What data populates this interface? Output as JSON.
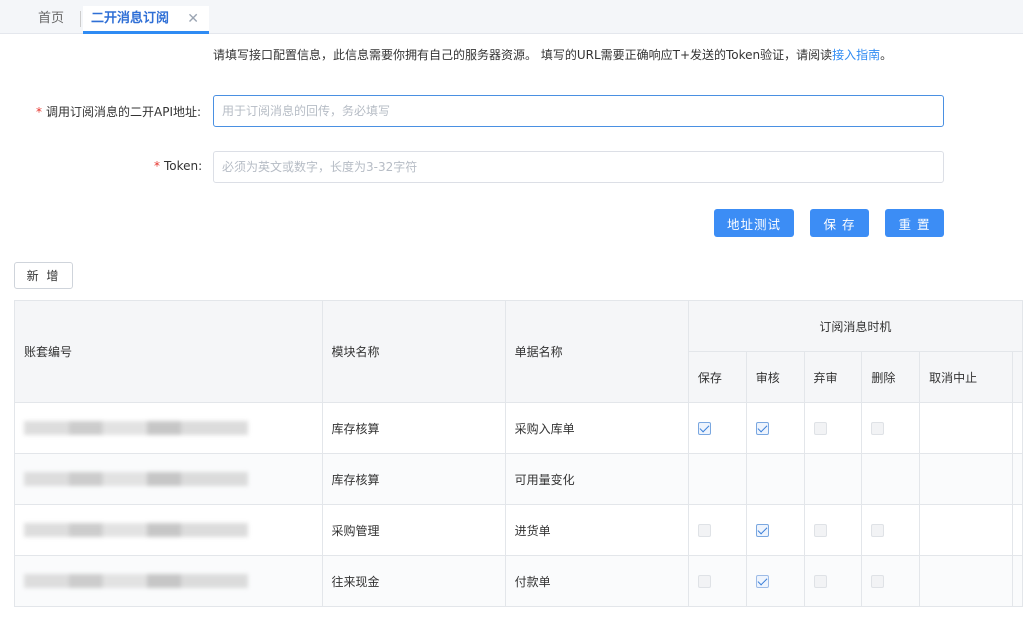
{
  "tabs": {
    "home": "首页",
    "active": "二开消息订阅",
    "close": "✕"
  },
  "notice": {
    "text": "请填写接口配置信息，此信息需要你拥有自己的服务器资源。 填写的URL需要正确响应T+发送的Token验证，请阅读",
    "link": "接入指南",
    "suffix": "。"
  },
  "form": {
    "required_mark": "*",
    "api_label": "调用订阅消息的二开API地址:",
    "api_placeholder": "用于订阅消息的回传，务必填写",
    "api_value": "",
    "token_label": "Token:",
    "token_placeholder": "必须为英文或数字，长度为3-32字符",
    "token_value": ""
  },
  "buttons": {
    "test": "地址测试",
    "save": "保 存",
    "reset": "重 置",
    "add": "新 增"
  },
  "table": {
    "headers": {
      "account": "账套编号",
      "module": "模块名称",
      "document": "单据名称",
      "group": "订阅消息时机"
    },
    "sub_headers": [
      "保存",
      "审核",
      "弃审",
      "删除",
      "取消中止"
    ],
    "rows": [
      {
        "account": "",
        "module": "库存核算",
        "document": "采购入库单",
        "checks": [
          {
            "state": "checked"
          },
          {
            "state": "checked"
          },
          {
            "state": "disabled"
          },
          {
            "state": "disabled"
          },
          {
            "state": "none"
          }
        ]
      },
      {
        "account": "",
        "module": "库存核算",
        "document": "可用量变化",
        "checks": [
          {
            "state": "none"
          },
          {
            "state": "none"
          },
          {
            "state": "none"
          },
          {
            "state": "none"
          },
          {
            "state": "none"
          }
        ]
      },
      {
        "account": "",
        "module": "采购管理",
        "document": "进货单",
        "checks": [
          {
            "state": "disabled"
          },
          {
            "state": "checked"
          },
          {
            "state": "disabled"
          },
          {
            "state": "disabled"
          },
          {
            "state": "none"
          }
        ]
      },
      {
        "account": "",
        "module": "往来现金",
        "document": "付款单",
        "checks": [
          {
            "state": "disabled"
          },
          {
            "state": "disabled-checked"
          },
          {
            "state": "disabled"
          },
          {
            "state": "disabled"
          },
          {
            "state": "none"
          }
        ]
      }
    ]
  },
  "colors": {
    "accent": "#3c8df5",
    "required": "#e6342d",
    "link": "#2f8bf3"
  }
}
